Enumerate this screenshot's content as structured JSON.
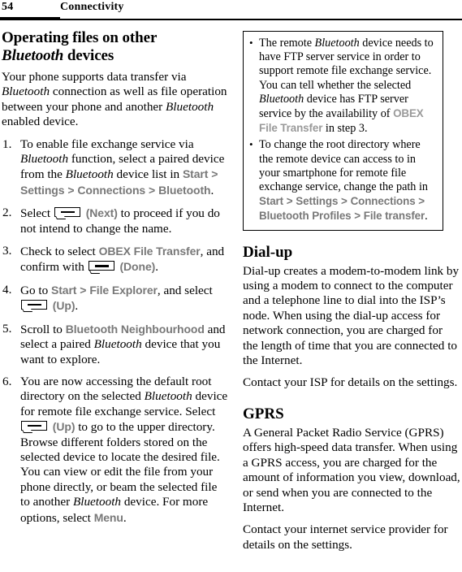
{
  "header": {
    "page_number": "54",
    "title": "Connectivity"
  },
  "left_column": {
    "section_heading_line1": "Operating files on other",
    "section_heading_italic": "Bluetooth",
    "section_heading_line2_rest": " devices",
    "intro_p1_a": "Your phone supports data transfer via ",
    "intro_p1_it1": "Bluetooth",
    "intro_p1_b": " connection as well as file operation between your phone and another ",
    "intro_p1_it2": "Bluetooth",
    "intro_p1_c": " enabled device.",
    "steps": [
      {
        "id": "step-1",
        "t1": "To enable file exchange service via ",
        "it1": "Bluetooth",
        "t2": " function, select a paired device from the ",
        "it2": "Bluetooth",
        "t3": " device list in ",
        "ui1": "Start",
        "sep1": " > ",
        "ui2": "Settings",
        "sep2": " > ",
        "ui3": "Connections",
        "sep3": " > ",
        "ui4": "Bluetooth",
        "t4": "."
      },
      {
        "id": "step-2",
        "t1": "Select ",
        "softkey": "softkey-icon",
        "ui1": "(Next)",
        "t2": " to proceed if you do not intend to change the name."
      },
      {
        "id": "step-3",
        "t1": "Check to select ",
        "ui1": "OBEX File Transfer",
        "t2": ", and confirm with ",
        "softkey": "softkey-icon",
        "ui2": "(Done)",
        "t3": "."
      },
      {
        "id": "step-4",
        "t1": "Go to ",
        "ui1": "Start",
        "sep1": " > ",
        "ui2": "File Explorer",
        "t2": ", and select ",
        "softkey": "softkey-icon",
        "ui3": "(Up)",
        "t3": "."
      },
      {
        "id": "step-5",
        "t1": "Scroll to ",
        "ui1": "Bluetooth Neighbourhood",
        "t2": " and select a paired ",
        "it1": "Bluetooth",
        "t3": " device that you want to explore."
      },
      {
        "id": "step-6",
        "t1": "You are now accessing the default root directory on the selected ",
        "it1": "Bluetooth",
        "t2": " device for remote file exchange service. Select ",
        "softkey": "softkey-icon",
        "ui1": "(Up)",
        "t3": " to go to the upper directory. Browse different folders stored on the selected device to locate the desired file. You can view or edit the file from your phone directly, or beam the selected file to another ",
        "it2": "Bluetooth",
        "t4": " device. For more options, select ",
        "ui2": "Menu",
        "t5": "."
      }
    ]
  },
  "right_column": {
    "note_box": {
      "bullets": [
        {
          "id": "note-bullet-1",
          "t1": "The remote ",
          "it1": "Bluetooth",
          "t2": " device needs to have FTP server service in order to support remote file exchange service. You can tell whether the selected ",
          "it2": "Bluetooth",
          "t3": " device has FTP server service by the availability of ",
          "ui1": "OBEX File Transfer",
          "t4": " in step 3."
        },
        {
          "id": "note-bullet-2",
          "t1": "To change the root directory where the remote device can access to in your smartphone for remote file exchange service, change the path in ",
          "ui1": "Start",
          "sep1": " > ",
          "ui2": "Settings",
          "sep2": " > ",
          "ui3": "Connections",
          "sep3": " > ",
          "ui4": "Bluetooth Profiles",
          "sep4": " > ",
          "ui5": "File transfer",
          "t2": "."
        }
      ]
    },
    "dialup": {
      "heading": "Dial-up",
      "p1": "Dial-up creates a modem-to-modem link by using a modem to connect to the computer and a telephone line to dial into the ISP’s node. When using the dial-up access for network connection, you are charged for the length of time that you are connected to the Internet.",
      "p2": "Contact your ISP for details on the settings."
    },
    "gprs": {
      "heading": "GPRS",
      "p1": "A General Packet Radio Service (GPRS) offers high-speed data transfer. When using a GPRS access, you are charged for the amount of information you view, download, or send when you are connected to the Internet.",
      "p2": "Contact your internet service provider for details on the settings."
    }
  },
  "colors": {
    "ui_term_gray": "#787878",
    "ui_term_gray_light": "#9a9a9a",
    "text_black": "#000000",
    "page_background": "#ffffff"
  }
}
